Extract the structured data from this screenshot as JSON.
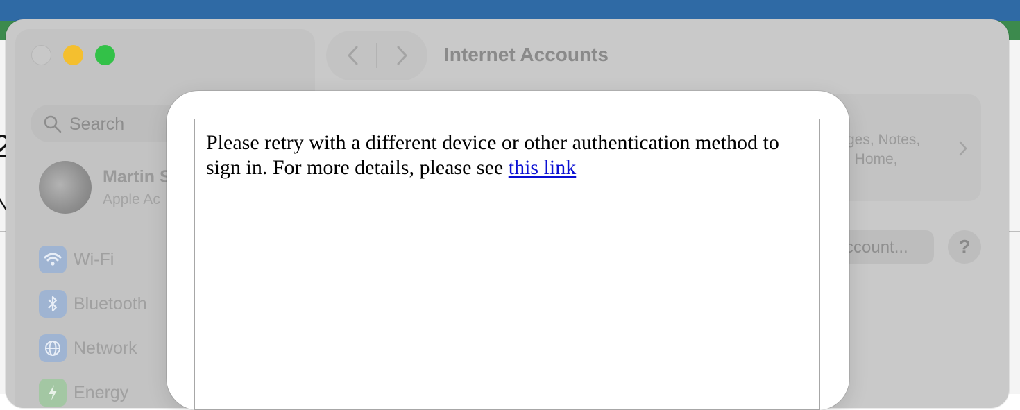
{
  "background": {
    "edge_char_1": "2",
    "edge_char_2": "N"
  },
  "window": {
    "title": "Internet Accounts",
    "back_icon": "chevron-left-icon",
    "forward_icon": "chevron-right-icon"
  },
  "sidebar": {
    "search_placeholder": "Search",
    "user": {
      "name": "Martin S",
      "subtitle": "Apple Ac"
    },
    "items": [
      {
        "label": "Wi-Fi",
        "icon": "wifi-icon"
      },
      {
        "label": "Bluetooth",
        "icon": "bluetooth-icon"
      },
      {
        "label": "Network",
        "icon": "globe-icon"
      },
      {
        "label": "Energy",
        "icon": "energy-icon"
      }
    ]
  },
  "main": {
    "account_card": {
      "line1": "ges, Notes,",
      "line2": ", Home,"
    },
    "add_account_label": "ccount...",
    "help_label": "?"
  },
  "sheet": {
    "message": "Please retry with a different device or other authentication method to sign in. For more details, please see",
    "link_text": "this link"
  },
  "colors": {
    "desktop_blue": "#2f6aa5",
    "desktop_green": "#3c8a4d",
    "traffic_minimize": "#f4bf2f",
    "traffic_maximize": "#33c148",
    "link": "#0b10d3"
  }
}
